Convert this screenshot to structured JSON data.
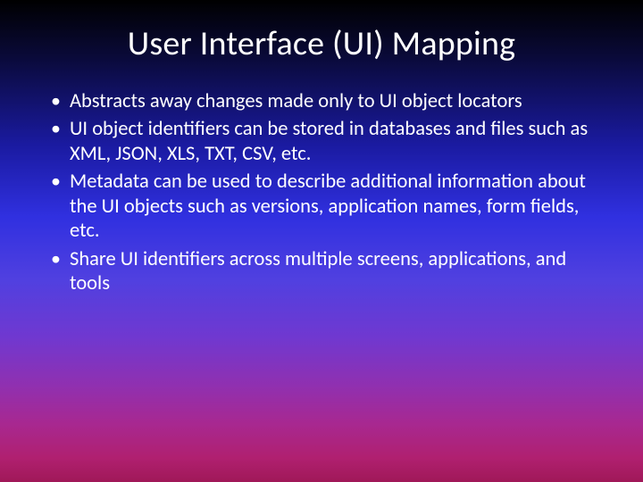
{
  "slide": {
    "title": "User Interface (UI) Mapping",
    "bullets": [
      "Abstracts away changes made only to UI object locators",
      "UI object identifiers can be stored in databases and files such as XML, JSON, XLS, TXT, CSV, etc.",
      "Metadata can be used to describe additional information about the UI objects such as versions, application names, form fields, etc.",
      "Share UI identifiers across multiple screens, applications, and tools"
    ]
  }
}
